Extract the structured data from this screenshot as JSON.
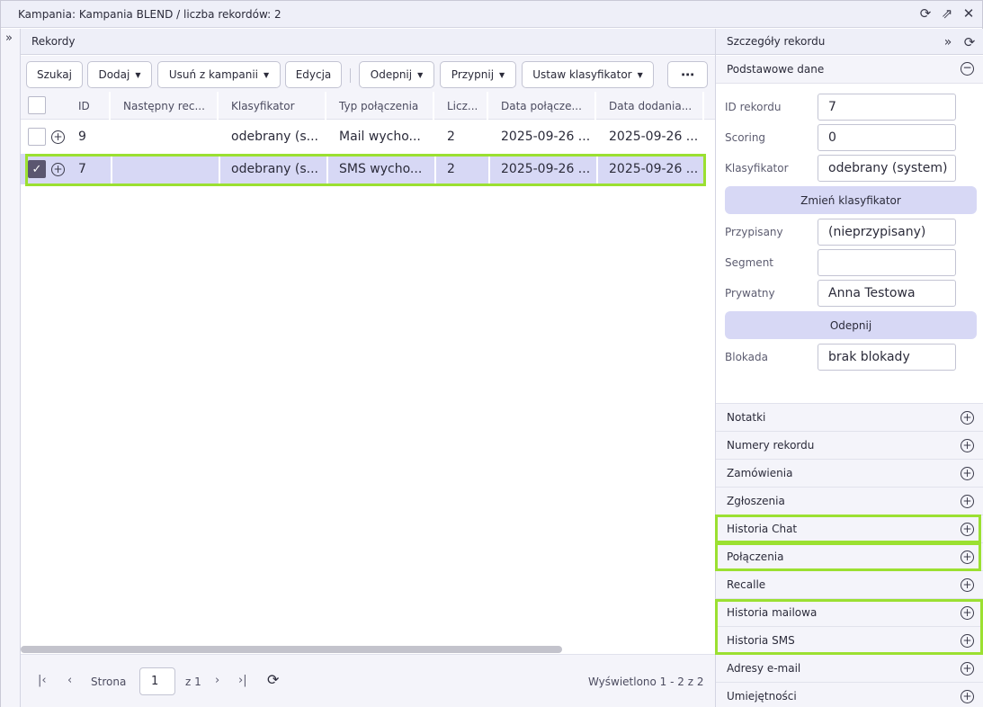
{
  "window": {
    "title": "Kampania: Kampania BLEND / liczba rekordów: 2",
    "icons": [
      "refresh-icon",
      "external-link-icon",
      "close-icon"
    ]
  },
  "sidebar": {
    "expand_icon": "double-chevron-right-icon"
  },
  "records": {
    "header": "Rekordy",
    "toolbar": {
      "search": "Szukaj",
      "add": "Dodaj",
      "remove": "Usuń z kampanii",
      "edit": "Edycja",
      "unpin": "Odepnij",
      "pin": "Przypnij",
      "set_classifier": "Ustaw klasyfikator",
      "more": "⋯"
    },
    "columns": [
      "ID",
      "Następny rec...",
      "Klasyfikator",
      "Typ połączenia",
      "Licz...",
      "Data połącze...",
      "Data dodania..."
    ],
    "rows": [
      {
        "id": "9",
        "next": "",
        "classifier": "odebrany (s...",
        "type": "Mail wycho...",
        "count": "2",
        "date_conn": "2025-09-26 ...",
        "date_added": "2025-09-26 ...",
        "selected": false
      },
      {
        "id": "7",
        "next": "",
        "classifier": "odebrany (s...",
        "type": "SMS wycho...",
        "count": "2",
        "date_conn": "2025-09-26 ...",
        "date_added": "2025-09-26 ...",
        "selected": true
      }
    ],
    "pager": {
      "page_label": "Strona",
      "page_value": "1",
      "of_label": "z 1",
      "summary": "Wyświetlono 1 - 2 z 2"
    }
  },
  "details": {
    "header": "Szczegóły rekordu",
    "basic_section": "Podstawowe dane",
    "fields": {
      "record_id_label": "ID rekordu",
      "record_id": "7",
      "scoring_label": "Scoring",
      "scoring": "0",
      "classifier_label": "Klasyfikator",
      "classifier": "odebrany (system)",
      "change_classifier_button": "Zmień klasyfikator",
      "assigned_label": "Przypisany",
      "assigned": "(nieprzypisany)",
      "segment_label": "Segment",
      "segment": "",
      "private_label": "Prywatny",
      "private": "Anna Testowa",
      "unpin_button": "Odepnij",
      "lock_label": "Blokada",
      "lock": "brak blokady"
    },
    "sections": [
      "Notatki",
      "Numery rekordu",
      "Zamówienia",
      "Zgłoszenia",
      "Historia Chat",
      "Połączenia",
      "Recalle",
      "Historia mailowa",
      "Historia SMS",
      "Adresy e-mail",
      "Umiejętności"
    ]
  },
  "colors": {
    "highlight": "#9be031",
    "selected_row": "#d7d8f5",
    "header_bg": "#eeeff8"
  }
}
